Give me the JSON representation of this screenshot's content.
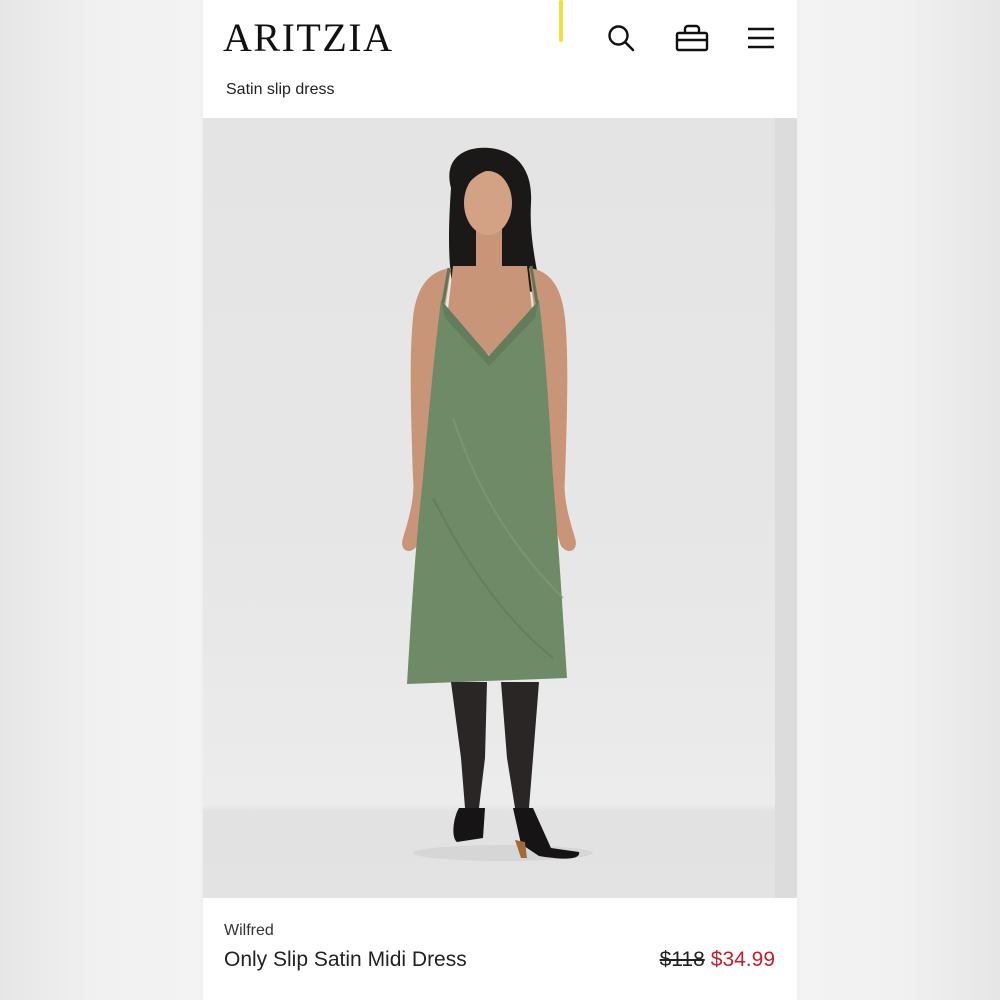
{
  "header": {
    "logo": "ARITZIA",
    "search_icon": "search-icon",
    "bag_icon": "shopping-bag-icon",
    "menu_icon": "hamburger-menu-icon"
  },
  "breadcrumb": "Satin slip dress",
  "product": {
    "image_alt": "Model wearing sage green satin slip midi dress with black sheer tights and strappy heels",
    "dress_color": "#6f8a67",
    "brand": "Wilfred",
    "name": "Only Slip Satin Midi Dress",
    "original_price": "$118",
    "sale_price": "$34.99",
    "sale_color": "#c2202b"
  }
}
